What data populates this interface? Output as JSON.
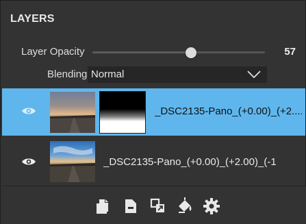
{
  "panel": {
    "title": "LAYERS"
  },
  "opacity": {
    "label": "Layer Opacity",
    "value": 57,
    "value_text": "57"
  },
  "blending": {
    "label": "Blending",
    "selected": "Normal"
  },
  "layers": [
    {
      "name": "_DSC2135-Pano_(+0.00)_(+2....",
      "visible": true,
      "selected": true,
      "has_mask": true
    },
    {
      "name": "_DSC2135-Pano_(+0.00)_(+2.00)_(-1",
      "visible": true,
      "selected": false,
      "has_mask": false
    }
  ],
  "toolbar": {
    "icons": [
      "new-layer-icon",
      "duplicate-layer-icon",
      "merge-layers-icon",
      "fill-bucket-icon",
      "gear-icon"
    ]
  },
  "colors": {
    "panel_bg": "#333333",
    "selected_row": "#5fb6ec",
    "text": "#e6e6e6"
  }
}
